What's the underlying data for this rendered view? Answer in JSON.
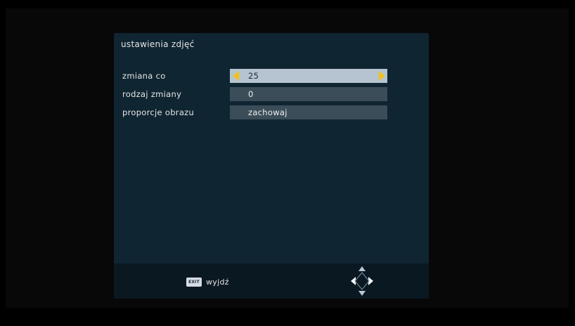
{
  "menu": {
    "title": "ustawienia zdjęć",
    "settings": [
      {
        "label": "zmiana co",
        "value": "25",
        "selected": true
      },
      {
        "label": "rodzaj zmiany",
        "value": "0",
        "selected": false
      },
      {
        "label": "proporcje obrazu",
        "value": "zachowaj",
        "selected": false
      }
    ]
  },
  "footer": {
    "exit_badge": "EXIT",
    "exit_label": "wyjdź",
    "nav_icon": "navigation-dpad-icon"
  },
  "colors": {
    "background": "#000000",
    "panel": "#0f2531",
    "value_box": "#3b4d58",
    "value_box_selected": "#b5c4d0",
    "arrow_accent": "#f2c21a"
  }
}
